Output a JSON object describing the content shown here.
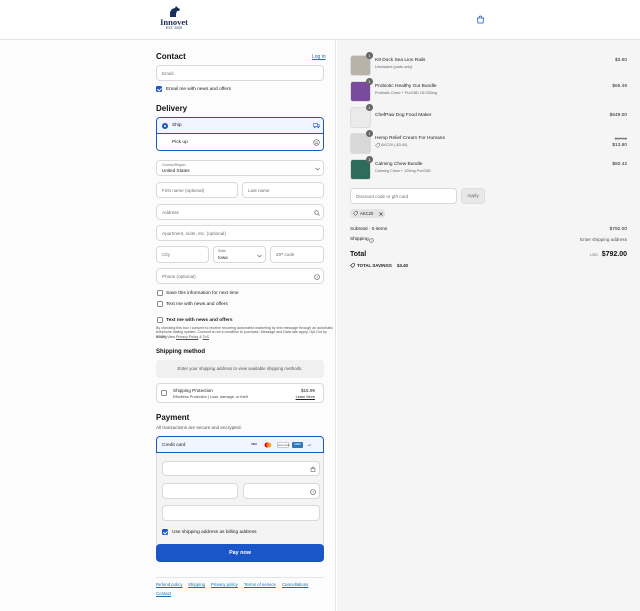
{
  "header": {
    "logo_text": "Innovet",
    "logo_sub": "EST. 2005"
  },
  "contact": {
    "title": "Contact",
    "login_link": "Log in",
    "email_placeholder": "Email",
    "news_offers_label": "Email me with news and offers"
  },
  "delivery": {
    "title": "Delivery",
    "option_ship": "Ship",
    "option_pickup": "Pick up",
    "country_label": "Country/Region",
    "country_value": "United States",
    "first_name_placeholder": "First name (optional)",
    "last_name_placeholder": "Last name",
    "address_placeholder": "Address",
    "apartment_placeholder": "Apartment, suite, etc. (optional)",
    "city_placeholder": "City",
    "state_label": "State",
    "state_value": "Iowa",
    "zip_placeholder": "ZIP code",
    "phone_placeholder": "Phone (optional)",
    "save_info_label": "Save this information for next time",
    "text_news_label": "Text me with news and offers",
    "text_me_title": "Text me with news and offers",
    "sms_disclaimer_1": "By checking this box I consent to receive recurring automated marketing by text message through an automatic",
    "sms_disclaimer_2": "telephone dialing system. Consent is not a condition to purchase. Message and Data rate apply. Opt Out by texting",
    "sms_disclaimer_3": "STOP. View",
    "privacy_policy_link": "Privacy Policy",
    "and_text": "&",
    "tos_link": "ToS"
  },
  "shipping_method": {
    "title": "Shipping method",
    "placeholder_text": "Enter your shipping address to view available shipping methods.",
    "protection_title": "Shipping Protection",
    "protection_price": "$15.99",
    "protection_desc": "Effortless Protection | Loss, damage, or theft",
    "learn_more": "Learn More"
  },
  "payment": {
    "title": "Payment",
    "subtitle": "All transactions are secure and encrypted.",
    "credit_card_label": "Credit card",
    "card_logos": [
      "VISA",
      "MC",
      "DISCOVER",
      "AMEX",
      "+3"
    ],
    "billing_label": "Use shipping address as billing address",
    "pay_button": "Pay now"
  },
  "footer": {
    "links": [
      "Refund policy",
      "Shipping",
      "Privacy policy",
      "Terms of service",
      "Cancellations",
      "Contact"
    ]
  },
  "order": {
    "items": [
      {
        "qty": "1",
        "name": "K9 Dock Sea Lion Rails",
        "variant": "Unshaded (parts only)",
        "price": "$3.50"
      },
      {
        "qty": "1",
        "name": "Probiotic Healthy Gut Bundle",
        "variant": "Probiotic Chew + PurCBD Oil 250mg",
        "price": "$65.48"
      },
      {
        "qty": "1",
        "name": "ChefPaw Dog Food Maker",
        "variant": "",
        "price": "$649.00"
      },
      {
        "qty": "1",
        "name": "Hemp Relief Cream For Humans",
        "variant": "",
        "discount": "AKC20 (-$3.40)",
        "old_price": "$17.00",
        "price": "$13.60"
      },
      {
        "qty": "1",
        "name": "Calming Chew Bundle",
        "variant": "Calming Chew + 125mg PurCBD",
        "price": "$60.42"
      }
    ],
    "discount_placeholder": "Discount code or gift card",
    "apply_button": "Apply",
    "applied_code": "AKC20",
    "subtotal_label": "Subtotal · 5 items",
    "subtotal_value": "$792.00",
    "shipping_label": "Shipping",
    "shipping_value": "Enter shipping address",
    "total_label": "Total",
    "total_currency": "USD",
    "total_value": "$792.00",
    "savings_label": "TOTAL SAVINGS",
    "savings_value": "$3.40"
  },
  "colors": {
    "accent": "#1a56c8",
    "link": "#1773b0"
  }
}
